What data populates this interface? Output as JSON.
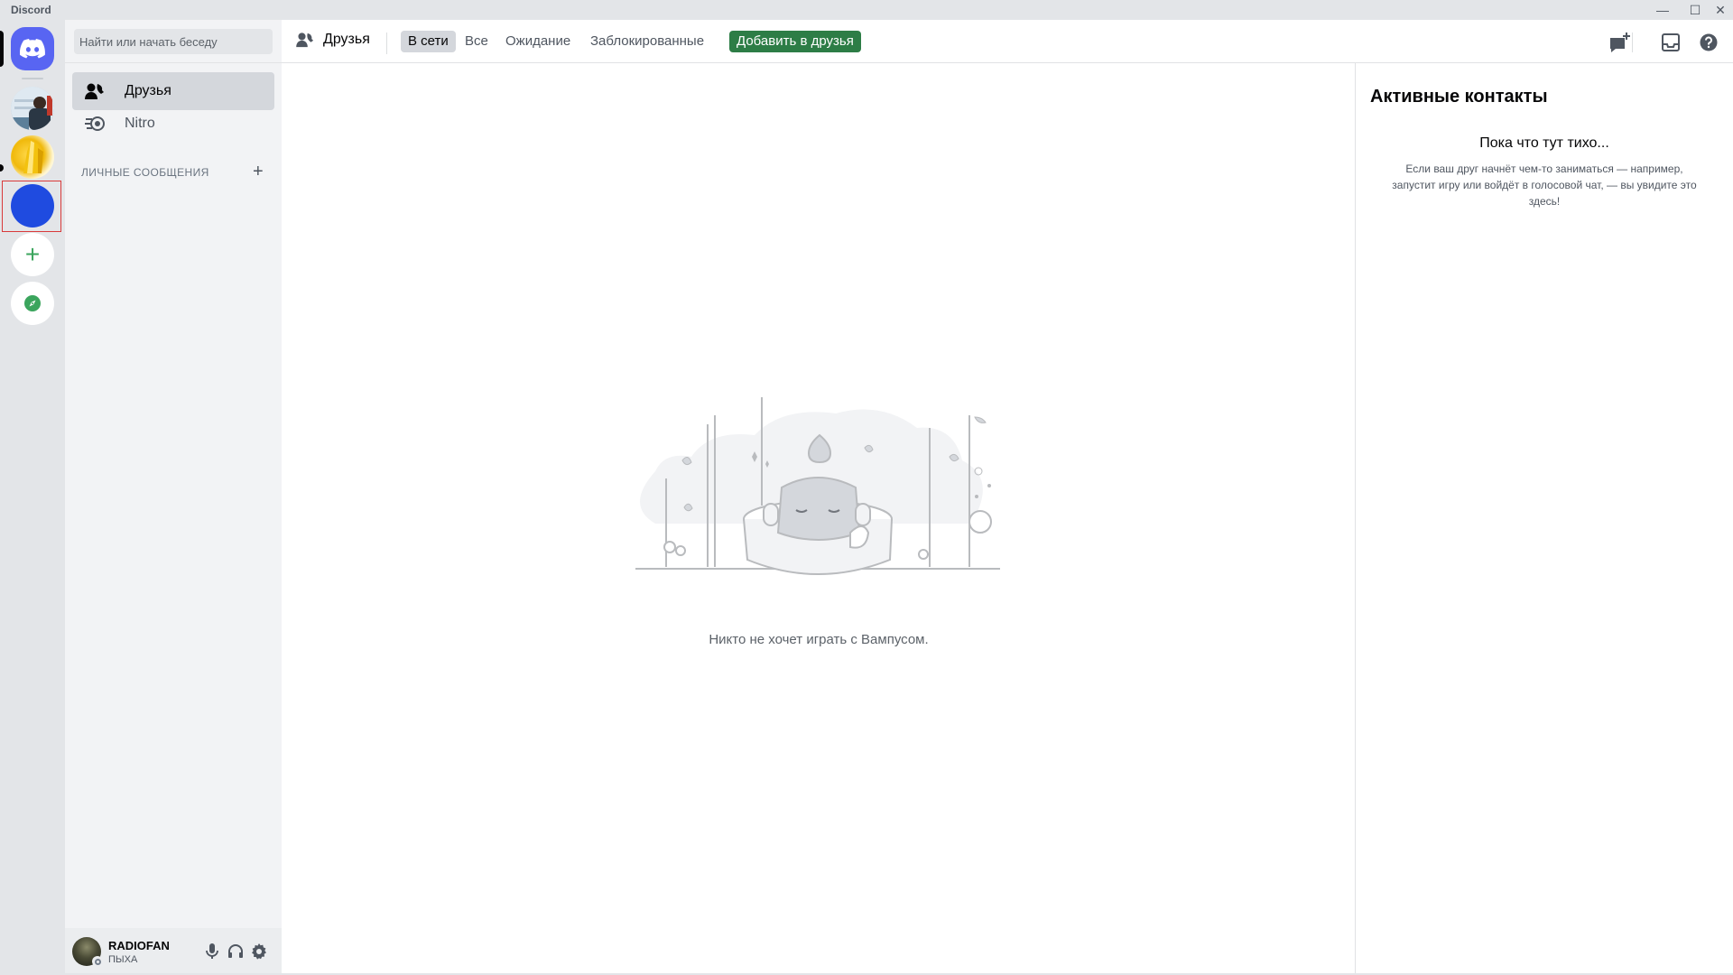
{
  "window": {
    "title": "Discord",
    "minimize_glyph": "—",
    "maximize_glyph": "☐",
    "close_glyph": "✕"
  },
  "servers": {
    "home_icon": "discord-logo-icon",
    "add_glyph": "+",
    "add_icon": "plus-icon",
    "explore_icon": "compass-icon",
    "items": [
      {
        "name": "server-avatar-photo"
      },
      {
        "name": "server-avatar-gold"
      },
      {
        "name": "server-avatar-blue"
      }
    ]
  },
  "sidebar": {
    "search_placeholder": "Найти или начать беседу",
    "items": [
      {
        "label": "Друзья",
        "icon": "friends-icon",
        "active": true
      },
      {
        "label": "Nitro",
        "icon": "nitro-icon",
        "active": false
      }
    ],
    "dm_header": "ЛИЧНЫЕ СООБЩЕНИЯ",
    "dm_add_glyph": "+"
  },
  "user": {
    "name": "RADIOFAN",
    "tag": "ПЫХА",
    "status": "offline"
  },
  "topbar": {
    "title": "Друзья",
    "tabs": [
      {
        "label": "В сети",
        "selected": true
      },
      {
        "label": "Все",
        "selected": false
      },
      {
        "label": "Ожидание",
        "selected": false
      },
      {
        "label": "Заблокированные",
        "selected": false
      }
    ],
    "add_friend_label": "Добавить в друзья",
    "icons": [
      "new-group-dm-icon",
      "inbox-icon",
      "help-icon"
    ]
  },
  "empty_state": {
    "text": "Никто не хочет играть с Вампусом."
  },
  "active_contacts": {
    "title": "Активные контакты",
    "subtitle": "Пока что тут тихо...",
    "description": "Если ваш друг начнёт чем-то заниматься — например, запустит игру или войдёт в голосовой чат, — вы увидите это здесь!"
  },
  "colors": {
    "brand": "#5865f2",
    "green": "#2d7d46",
    "server_bar": "#e3e5e8",
    "sidebar": "#f2f3f5"
  }
}
